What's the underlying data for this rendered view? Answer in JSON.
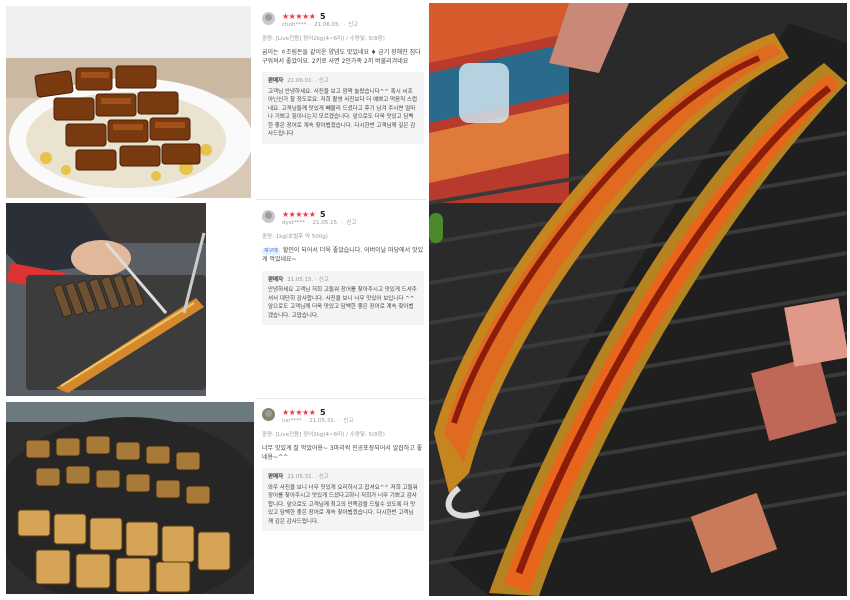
{
  "reviews": [
    {
      "stars": "★★★★★",
      "score": "5",
      "user": "choh****",
      "date": "21.06.05.",
      "report": "신고",
      "option": "중량: [Live전용] 장어2kg(4~6미) / 수량및: 5(8장)",
      "body": "굽이는 ㅎ조림돈들 같이운 양념도 맛있네요 ♦ 금기 장해진 짐다 구워져서 좋았어요. 2키로 사면 2인가족 2끼 버불리겨네요",
      "reply": {
        "name": "판매자",
        "date": "21.06.01.",
        "report": "신고",
        "text": "고객님 안녕하세요. 사진을 보고 깜짝 놀랐습니다^^ 혹시 씨프 아닌신가 할 정도로요. 저희 촬영 사진보다 더 예쁘고 먹음직 스럽네요. 고객님들께 맛있게 빼불리 드셨다고 후기 남겨 주시면 얼마나 기쁘고 힘이나는지 모르겠습니다. 앞으로도 더욱 맛있고 담백한 좋은 장어로 계속 찾아뵙겠습니다. 다시한번 고객님께 깊은 감사드립니다"
      }
    },
    {
      "stars": "★★★★★",
      "score": "5",
      "user": "dyst****",
      "date": "21.05.15.",
      "report": "신고",
      "option": "중량: 1kg(초벌후 약 500g)",
      "tag": "재구매",
      "body": "할인이 되어서 더욱 좋았습니다. 어버이날 마당에서 맛있게 먹었네요~",
      "reply": {
        "name": "판매자",
        "date": "21.05.15.",
        "report": "신고",
        "text": "안녕하세요 고객님 저희 고들워 장어를 찾아주시고 맛있게 드셔주셔서 대단히 감사합니다. 사진을 보니 너무 맛있어 보입니다 ^^ 앞으로도 고객님께 더욱 맛있고 담백한 좋은 장어로 계속 찾아뵙겠습니다. 고맙습니다."
      }
    },
    {
      "stars": "★★★★★",
      "score": "5",
      "user": "lun****",
      "date": "21.05.31.",
      "report": "신고",
      "option": "중량: [Live전용] 장어2kg(4~6미) / 수량및: 5(8장)",
      "body": "너무 맛있게 잘 먹었어용~ 3마리씩 진공포장되어서 알잡하고 좋네용~^^",
      "reply": {
        "name": "판매자",
        "date": "21.05.31.",
        "report": "신고",
        "text": "와우 사진을 보니 너무 맛있게 요리하시고 잡셔요^^ 저희 고들워 장어를 찾아주시고 맛있게 드셨다고하니 저희가 너무 기쁘고 감사합니다. 앞으로도 고객님께 최고의 만족감을 드릴수 있도록 더 맛있고 담백한 좋은 장어로 계속 찾아뵙겠습니다. 다시한번 고객님께 깊은 감사드립니다."
      }
    }
  ],
  "photos": {
    "p1": "eel-rice-bowl-photo",
    "p2": "cutting-eel-with-scissors-photo",
    "p3": "grilled-eel-pieces-photo",
    "p4": "large-eel-on-grill-photo"
  }
}
